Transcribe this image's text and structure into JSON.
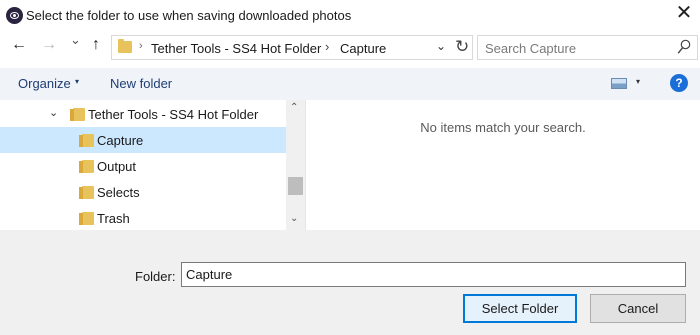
{
  "window": {
    "title": "Select the folder to use when saving downloaded photos",
    "close_glyph": "✕"
  },
  "nav": {
    "back": "←",
    "forward": "→",
    "recent": "⌄",
    "up": "↑"
  },
  "address": {
    "breadcrumbs": [
      "Tether Tools - SS4 Hot Folder",
      "Capture"
    ],
    "separator": "›",
    "leading_chevron": "›",
    "dropdown": "⌄",
    "refresh": "↻"
  },
  "search": {
    "placeholder": "Search Capture"
  },
  "toolbar": {
    "organize": "Organize",
    "organize_caret": "▾",
    "new_folder": "New folder",
    "view_caret": "▾",
    "help": "?"
  },
  "tree": {
    "parent": {
      "label": "Tether Tools - SS4 Hot Folder",
      "expander": "⌄"
    },
    "children": [
      {
        "label": "Capture",
        "selected": true
      },
      {
        "label": "Output"
      },
      {
        "label": "Selects"
      },
      {
        "label": "Trash"
      }
    ],
    "scroll_up": "⌃",
    "scroll_down": "⌄"
  },
  "content": {
    "empty_message": "No items match your search."
  },
  "footer": {
    "folder_label": "Folder:",
    "folder_value": "Capture",
    "select_button": "Select Folder",
    "cancel_button": "Cancel"
  },
  "colors": {
    "accent": "#0078d7",
    "selection": "#cce8ff",
    "toolbar_bg": "#f0f4f9",
    "folder_yellow": "#e8c25a"
  }
}
